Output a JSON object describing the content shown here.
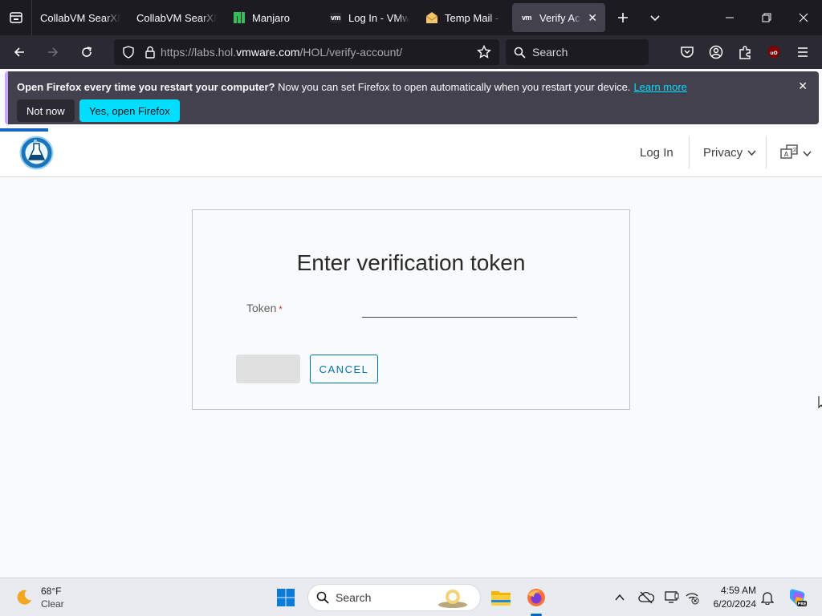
{
  "browser": {
    "tabs": [
      {
        "title": "CollabVM SearXNG",
        "favicon": "collabvm-icon"
      },
      {
        "title": "CollabVM SearXNG",
        "favicon": "collabvm-icon"
      },
      {
        "title": "Manjaro",
        "favicon": "manjaro-icon"
      },
      {
        "title": "Log In - VMware",
        "favicon": "vmware-icon"
      },
      {
        "title": "Temp Mail - Temp",
        "favicon": "mail-icon"
      },
      {
        "title": "Verify Account",
        "favicon": "vmware-icon",
        "active": true
      }
    ],
    "url": {
      "prefix": "https://labs.hol.",
      "host": "vmware.com",
      "path": "/HOL/verify-account/"
    },
    "search_placeholder": "Search",
    "colors": {
      "frame": "#1c1b22",
      "toolbar": "#2b2a33",
      "accent": "#00ddff"
    }
  },
  "notification": {
    "bold": "Open Firefox every time you restart your computer?",
    "text": " Now you can set Firefox to open automatically when you restart your device.",
    "link": "Learn more",
    "btn_not_now": "Not now",
    "btn_yes": "Yes, open Firefox"
  },
  "site": {
    "nav": {
      "login": "Log In",
      "privacy": "Privacy"
    },
    "form": {
      "title": "Enter verification token",
      "token_label": "Token",
      "required_mark": "*",
      "token_value": "",
      "submit_label": "",
      "cancel_label": "CANCEL"
    },
    "colors": {
      "primary": "#0072a3",
      "required": "#c92100"
    }
  },
  "taskbar": {
    "weather": {
      "temp": "68°F",
      "condition": "Clear"
    },
    "search_placeholder": "Search",
    "time": "4:59 AM",
    "date": "6/20/2024"
  }
}
